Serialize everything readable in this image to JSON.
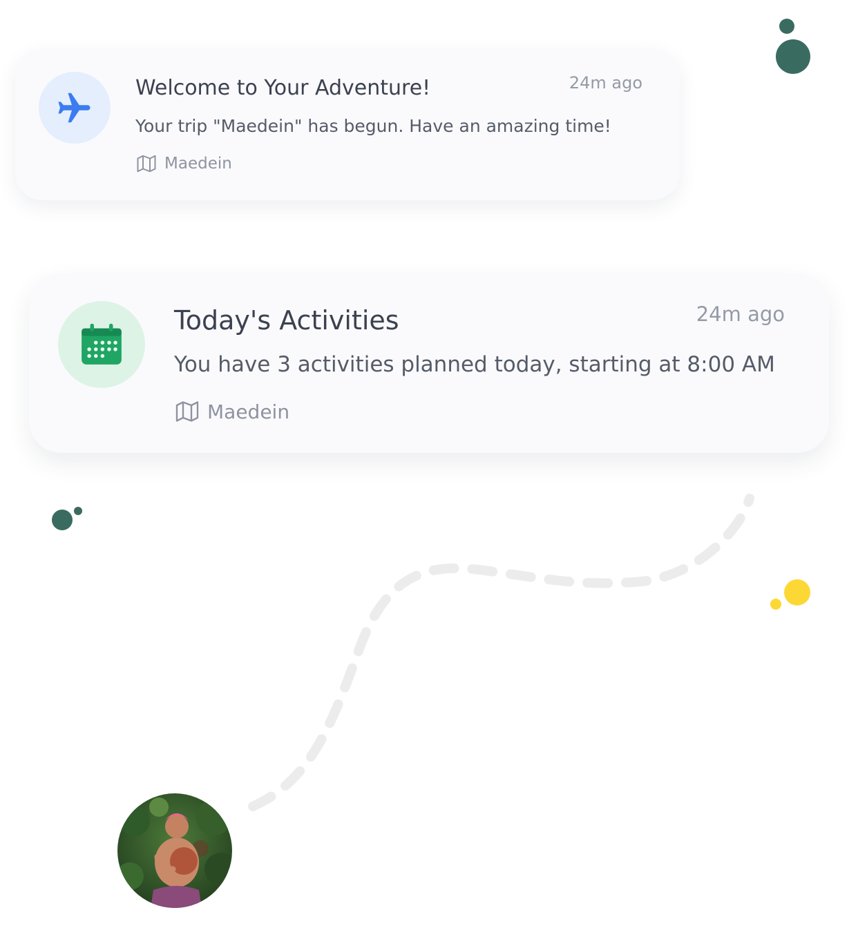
{
  "notifications": [
    {
      "icon": "airplane-icon",
      "title": "Welcome to Your Adventure!",
      "time": "24m ago",
      "message": "Your trip \"Maedein\" has begun. Have an amazing time!",
      "trip": "Maedein"
    },
    {
      "icon": "calendar-icon",
      "title": "Today's Activities",
      "time": "24m ago",
      "message": "You have 3 activities planned today, starting at 8:00 AM",
      "trip": "Maedein"
    }
  ],
  "colors": {
    "accent_blue": "#3b7cf0",
    "accent_green": "#1fa564",
    "decor_dark_green": "#3a6b60",
    "decor_yellow": "#fdd835",
    "path_gray": "#ececec"
  }
}
